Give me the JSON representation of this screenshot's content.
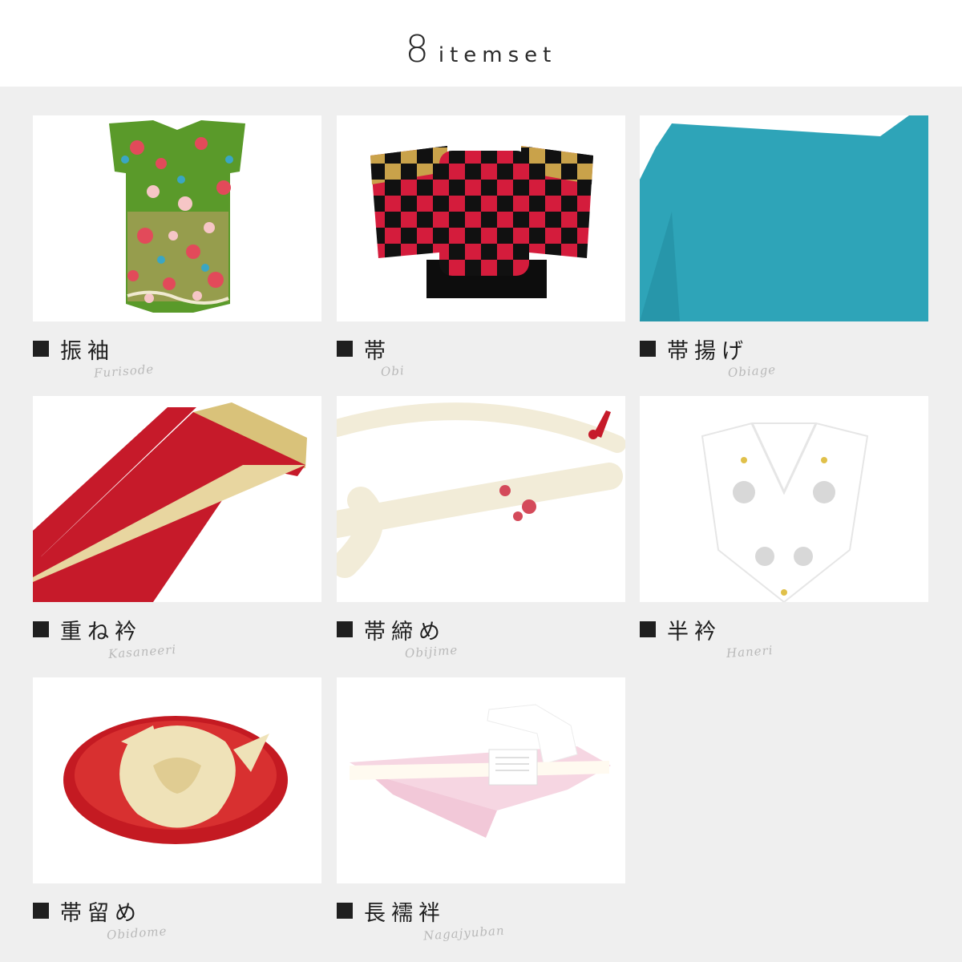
{
  "header": {
    "number": "8",
    "word": "itemset"
  },
  "items": [
    {
      "name": "振袖",
      "romaji": "Furisode"
    },
    {
      "name": "帯",
      "romaji": "Obi"
    },
    {
      "name": "帯揚げ",
      "romaji": "Obiage"
    },
    {
      "name": "重ね衿",
      "romaji": "Kasaneeri"
    },
    {
      "name": "帯締め",
      "romaji": "Obijime"
    },
    {
      "name": "半衿",
      "romaji": "Haneri"
    },
    {
      "name": "帯留め",
      "romaji": "Obidome"
    },
    {
      "name": "長襦袢",
      "romaji": "Nagajyuban"
    }
  ],
  "colors": {
    "background": "#efefef",
    "card": "#ffffff",
    "label_square": "#1f1f1f",
    "romaji": "#b9b9b9"
  }
}
